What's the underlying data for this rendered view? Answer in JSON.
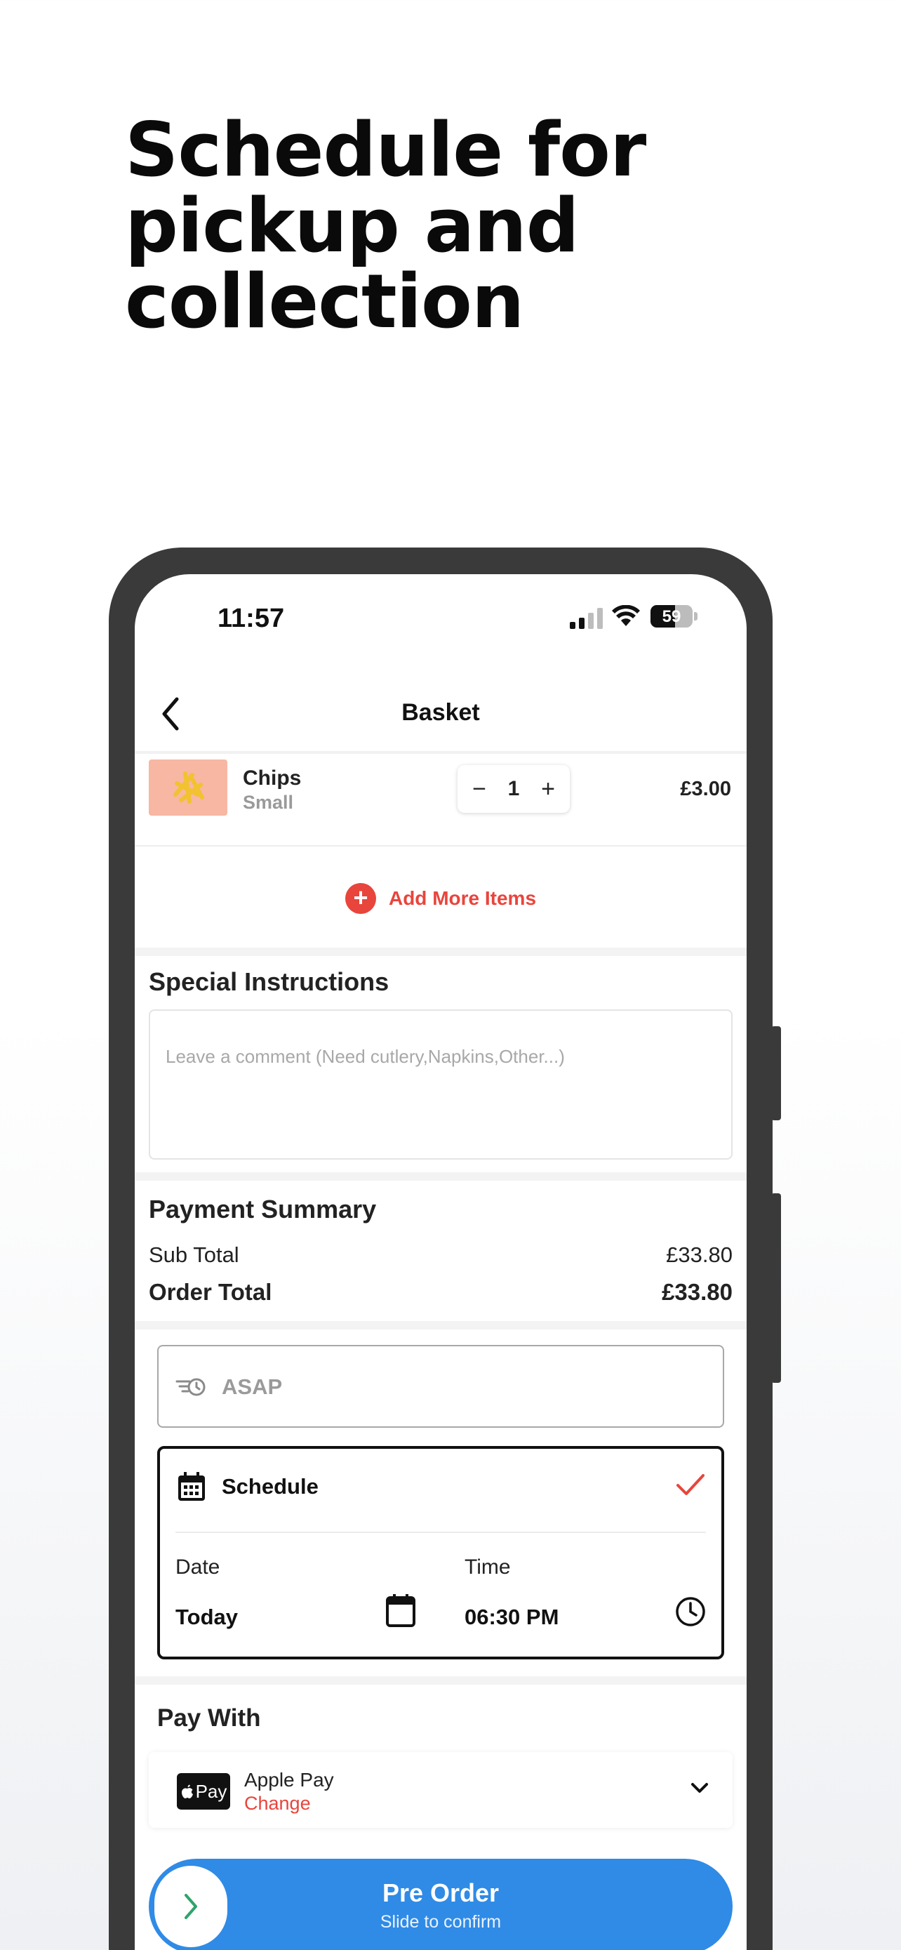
{
  "headline": "Schedule for pickup and collection",
  "status_bar": {
    "time": "11:57",
    "battery": "59"
  },
  "nav": {
    "title": "Basket"
  },
  "basket_item": {
    "name": "Chips",
    "size": "Small",
    "quantity": "1",
    "price": "£3.00",
    "minus": "−",
    "plus": "+"
  },
  "add_more": {
    "icon": "+",
    "label": "Add More Items"
  },
  "special_instructions": {
    "title": "Special Instructions",
    "placeholder": "Leave a comment (Need cutlery,Napkins,Other...)"
  },
  "payment_summary": {
    "title": "Payment Summary",
    "subtotal_label": "Sub Total",
    "subtotal_value": "£33.80",
    "total_label": "Order Total",
    "total_value": "£33.80"
  },
  "timing": {
    "asap_label": "ASAP",
    "schedule_label": "Schedule",
    "schedule_selected": true,
    "date_label": "Date",
    "date_value": "Today",
    "time_label": "Time",
    "time_value": "06:30 PM"
  },
  "pay_with": {
    "title": "Pay With",
    "badge": "Pay",
    "method": "Apple Pay",
    "change": "Change"
  },
  "cta": {
    "label": "Pre Order",
    "sublabel": "Slide to confirm"
  },
  "colors": {
    "accent_red": "#e8453c",
    "cta_blue": "#2f8be6",
    "check_green": "#2ea46b"
  },
  "icons": [
    "back-chevron-icon",
    "signal-icon",
    "wifi-icon",
    "battery-icon",
    "add-icon",
    "asap-clock-icon",
    "calendar-icon",
    "check-icon",
    "clock-icon",
    "apple-logo-icon",
    "chevron-down-icon",
    "chevron-right-icon"
  ]
}
